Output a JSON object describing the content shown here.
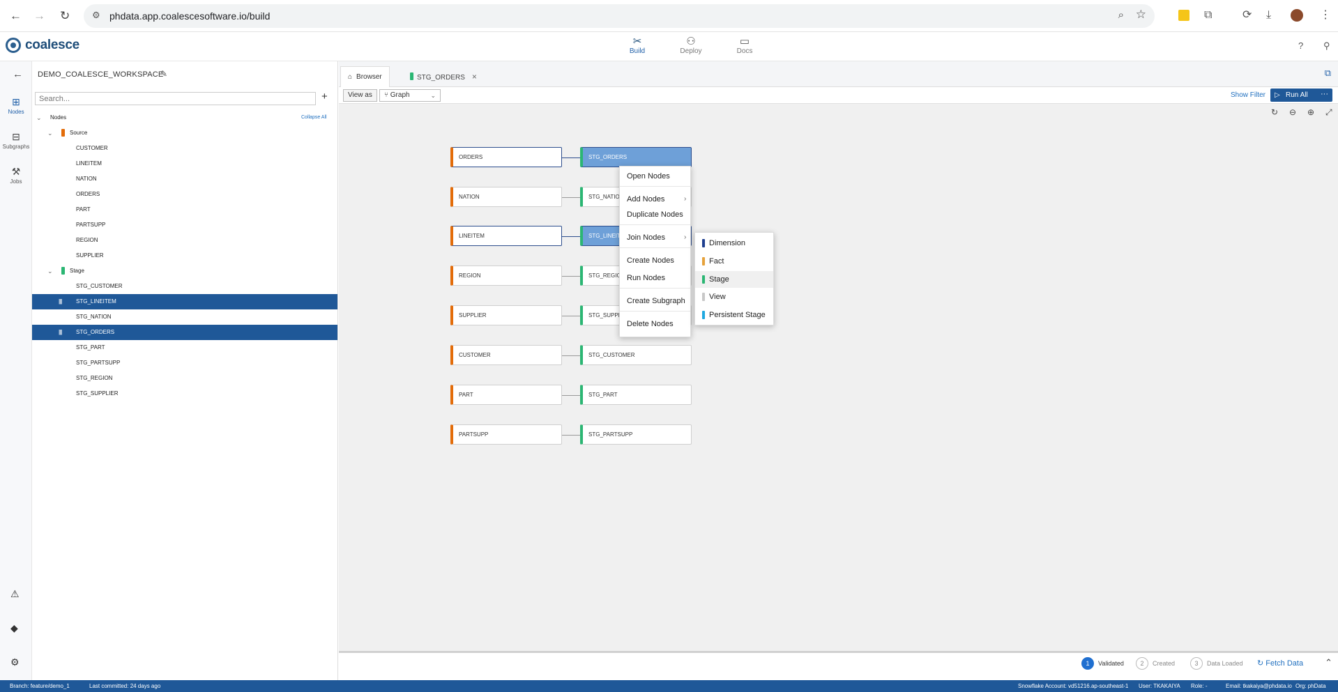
{
  "browser": {
    "url": "phdata.app.coalescesoftware.io/build"
  },
  "app": {
    "logo_text": "coalesce",
    "nav": [
      {
        "label": "Build",
        "icon": "build-icon",
        "active": true
      },
      {
        "label": "Deploy",
        "icon": "deploy-icon",
        "active": false
      },
      {
        "label": "Docs",
        "icon": "docs-icon",
        "active": false
      }
    ]
  },
  "rail": {
    "items": [
      {
        "label": "Nodes",
        "icon": "nodes-icon",
        "active": true
      },
      {
        "label": "Subgraphs",
        "icon": "subgraphs-icon",
        "active": false
      },
      {
        "label": "Jobs",
        "icon": "jobs-icon",
        "active": false
      }
    ]
  },
  "sidebar": {
    "workspace": "DEMO_COALESCE_WORKSPACE",
    "search_placeholder": "Search...",
    "root_label": "Nodes",
    "collapse_label": "Collapse All",
    "groups": [
      {
        "label": "Source",
        "color": "#e36c09",
        "items": [
          "CUSTOMER",
          "LINEITEM",
          "NATION",
          "ORDERS",
          "PART",
          "PARTSUPP",
          "REGION",
          "SUPPLIER"
        ]
      },
      {
        "label": "Stage",
        "color": "#2bb673",
        "items": [
          "STG_CUSTOMER",
          "STG_LINEITEM",
          "STG_NATION",
          "STG_ORDERS",
          "STG_PART",
          "STG_PARTSUPP",
          "STG_REGION",
          "STG_SUPPLIER"
        ],
        "selected": [
          "STG_LINEITEM",
          "STG_ORDERS"
        ]
      }
    ]
  },
  "tabs": {
    "browser_label": "Browser",
    "open_tab_label": "STG_ORDERS"
  },
  "toolbar": {
    "view_as_label": "View as",
    "view_mode": "Graph",
    "show_filter": "Show Filter",
    "run_all": "Run All"
  },
  "graph": {
    "rows": [
      {
        "source": "ORDERS",
        "stage": "STG_ORDERS"
      },
      {
        "source": "NATION",
        "stage": "STG_NATION"
      },
      {
        "source": "LINEITEM",
        "stage": "STG_LINEITEM"
      },
      {
        "source": "REGION",
        "stage": "STG_REGION"
      },
      {
        "source": "SUPPLIER",
        "stage": "STG_SUPPLIER"
      },
      {
        "source": "CUSTOMER",
        "stage": "STG_CUSTOMER"
      },
      {
        "source": "PART",
        "stage": "STG_PART"
      },
      {
        "source": "PARTSUPP",
        "stage": "STG_PARTSUPP"
      }
    ]
  },
  "context_menu": {
    "items": [
      "Open Nodes",
      "Add Nodes",
      "Duplicate Nodes",
      "Join Nodes",
      "Create Nodes",
      "Run Nodes",
      "Create Subgraph",
      "Delete Nodes"
    ]
  },
  "submenu": {
    "items": [
      {
        "label": "Dimension",
        "color": "#1f3f8f"
      },
      {
        "label": "Fact",
        "color": "#e6a23c"
      },
      {
        "label": "Stage",
        "color": "#2bb673"
      },
      {
        "label": "View",
        "color": "#c8c8c8"
      },
      {
        "label": "Persistent Stage",
        "color": "#1fa8e0"
      }
    ]
  },
  "bottom": {
    "steps": [
      {
        "num": "1",
        "label": "Validated"
      },
      {
        "num": "2",
        "label": "Created"
      },
      {
        "num": "3",
        "label": "Data Loaded"
      }
    ],
    "fetch_data": "Fetch Data"
  },
  "status": {
    "branch": "Branch: feature/demo_1",
    "last_committed": "Last committed: 24 days ago",
    "account": "Snowflake Account: vd51216.ap-southeast-1",
    "user": "User: TKAKAIYA",
    "role": "Role: -",
    "email": "Email: tkakaiya@phdata.io",
    "org": "Org: phData"
  }
}
